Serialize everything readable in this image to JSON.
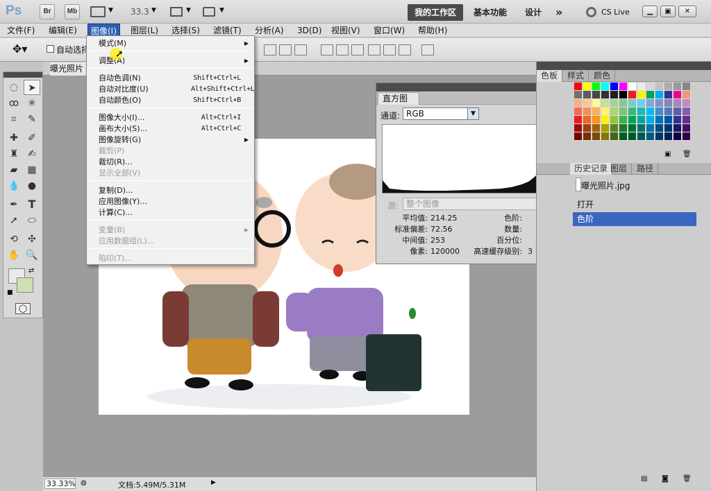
{
  "app": {
    "logo": "Ps",
    "br": "Br",
    "mb": "Mb",
    "zoom": "33.3"
  },
  "workspaces": {
    "mine": "我的工作区",
    "basic": "基本功能",
    "design": "设计",
    "more": "»",
    "cslive": "CS Live"
  },
  "menubar": [
    "文件(F)",
    "编辑(E)",
    "图像(I)",
    "图层(L)",
    "选择(S)",
    "滤镜(T)",
    "分析(A)",
    "3D(D)",
    "视图(V)",
    "窗口(W)",
    "帮助(H)"
  ],
  "options": {
    "auto_select": "自动选择"
  },
  "document": {
    "tab": "曝光照片"
  },
  "image_menu": [
    {
      "label": "模式(M)",
      "shortcut": "",
      "sub": true,
      "disabled": false
    },
    {
      "label": "调整(A)",
      "shortcut": "",
      "sub": true,
      "disabled": false
    },
    {
      "label": "自动色调(N)",
      "shortcut": "Shift+Ctrl+L",
      "sub": false,
      "disabled": false
    },
    {
      "label": "自动对比度(U)",
      "shortcut": "Alt+Shift+Ctrl+L",
      "sub": false,
      "disabled": false
    },
    {
      "label": "自动颜色(O)",
      "shortcut": "Shift+Ctrl+B",
      "sub": false,
      "disabled": false
    },
    {
      "label": "图像大小(I)...",
      "shortcut": "Alt+Ctrl+I",
      "sub": false,
      "disabled": false
    },
    {
      "label": "画布大小(S)...",
      "shortcut": "Alt+Ctrl+C",
      "sub": false,
      "disabled": false
    },
    {
      "label": "图像旋转(G)",
      "shortcut": "",
      "sub": true,
      "disabled": false
    },
    {
      "label": "裁剪(P)",
      "shortcut": "",
      "sub": false,
      "disabled": true
    },
    {
      "label": "裁切(R)...",
      "shortcut": "",
      "sub": false,
      "disabled": false
    },
    {
      "label": "显示全部(V)",
      "shortcut": "",
      "sub": false,
      "disabled": true
    },
    {
      "label": "复制(D)...",
      "shortcut": "",
      "sub": false,
      "disabled": false
    },
    {
      "label": "应用图像(Y)...",
      "shortcut": "",
      "sub": false,
      "disabled": false
    },
    {
      "label": "计算(C)...",
      "shortcut": "",
      "sub": false,
      "disabled": false
    },
    {
      "label": "变量(B)",
      "shortcut": "",
      "sub": true,
      "disabled": true
    },
    {
      "label": "应用数据组(L)...",
      "shortcut": "",
      "sub": false,
      "disabled": true
    },
    {
      "label": "陷印(T)...",
      "shortcut": "",
      "sub": false,
      "disabled": true
    }
  ],
  "histogram": {
    "title": "直方图",
    "channel_label": "通道:",
    "channel_value": "RGB",
    "source_label": "源:",
    "source_value": "整个图像",
    "mean_label": "平均值:",
    "mean": "214.25",
    "std_label": "标准偏差:",
    "std": "72.56",
    "median_label": "中间值:",
    "median": "253",
    "pixels_label": "像素:",
    "pixels": "120000",
    "level_label": "色阶:",
    "level": "",
    "count_label": "数量:",
    "count": "",
    "percent_label": "百分位:",
    "percent": "",
    "cache_label": "高速缓存级别:",
    "cache": "3"
  },
  "right_panels": {
    "tabs1": [
      "色板",
      "样式",
      "颜色"
    ],
    "tabs2": [
      "历史记录",
      "图层",
      "路径"
    ],
    "history": {
      "snapshot": "曝光照片.jpg",
      "items": [
        "打开",
        "色阶"
      ]
    }
  },
  "status": {
    "zoom": "33.33%",
    "doc": "文档:5.49M/5.31M"
  }
}
